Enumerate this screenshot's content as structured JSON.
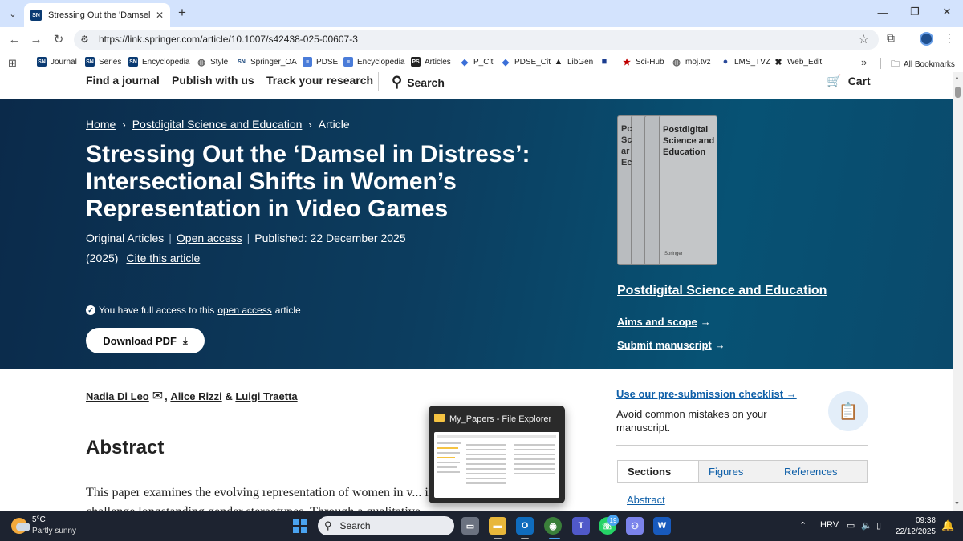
{
  "browser": {
    "tab_title": "Stressing Out the 'Damsel in Di...",
    "url": "https://link.springer.com/article/10.1007/s42438-025-00607-3",
    "bookmarks": [
      {
        "label": "Journal",
        "icon": "SN",
        "color": "#0a3a72"
      },
      {
        "label": "Series",
        "icon": "SN",
        "color": "#0a3a72"
      },
      {
        "label": "Encyclopedia",
        "icon": "SN",
        "color": "#0a3a72"
      },
      {
        "label": "Style",
        "icon": "globe",
        "color": "#666666"
      },
      {
        "label": "Springer_OA",
        "icon": "SN",
        "color": "#ffffff"
      },
      {
        "label": "PDSE",
        "icon": "doc",
        "color": "#4a7cd9"
      },
      {
        "label": "Encyclopedia",
        "icon": "doc",
        "color": "#4a7cd9"
      },
      {
        "label": "Articles",
        "icon": "PS",
        "color": "#222222"
      },
      {
        "label": "P_Cit",
        "icon": "diamond",
        "color": "#3b6fd8"
      },
      {
        "label": "PDSE_Cit",
        "icon": "diamond",
        "color": "#3b6fd8"
      },
      {
        "label": "LibGen",
        "icon": "chart",
        "color": "#222222"
      },
      {
        "label": "",
        "icon": "flag",
        "color": "#1a3c8f"
      },
      {
        "label": "Sci-Hub",
        "icon": "star",
        "color": "#c00000"
      },
      {
        "label": "moj.tvz",
        "icon": "globe",
        "color": "#666666"
      },
      {
        "label": "LMS_TVZ",
        "icon": "circle",
        "color": "#2a4a9a"
      },
      {
        "label": "Web_Edit",
        "icon": "x",
        "color": "#222222"
      }
    ],
    "all_bookmarks": "All Bookmarks"
  },
  "site_nav": {
    "find_journal": "Find a journal",
    "publish": "Publish with us",
    "track": "Track your research",
    "search": "Search",
    "cart": "Cart"
  },
  "breadcrumb": {
    "home": "Home",
    "journal": "Postdigital Science and Education",
    "current": "Article"
  },
  "article": {
    "title": "Stressing Out the ‘Damsel in Distress’: Intersectional Shifts in Women’s Representation in Video Games",
    "type": "Original Articles",
    "open_access": "Open access",
    "published": "Published: 22 December 2025",
    "year": "(2025)",
    "cite": "Cite this article",
    "access_prefix": "You have full access to this",
    "access_link": "open access",
    "access_suffix": "article",
    "download": "Download PDF",
    "authors": [
      {
        "name": "Nadia Di Leo"
      },
      {
        "name": "Alice Rizzi"
      },
      {
        "name": "Luigi Traetta"
      }
    ],
    "author_sep1": ",",
    "author_sep2": "&",
    "abstract_heading": "Abstract",
    "abstract_text": "This paper examines the evolving representation of women in v... intersectional shifts that challenge longstanding gender stereotypes. Through a qualitative"
  },
  "journal": {
    "cover_title": "Postdigital Science and Education",
    "cover_spine": "Pc Sc ar Ec",
    "cover_publisher": "Springer",
    "name": "Postdigital Science and Education",
    "aims": "Aims and scope",
    "submit": "Submit manuscript"
  },
  "sidebar": {
    "checklist_link": "Use our pre-submission checklist",
    "checklist_desc": "Avoid common mistakes on your manuscript.",
    "tabs": [
      "Sections",
      "Figures",
      "References"
    ],
    "first_section": "Abstract"
  },
  "popup": {
    "title": "My_Papers - File Explorer"
  },
  "taskbar": {
    "temp": "5°C",
    "condition": "Partly sunny",
    "search": "Search",
    "whatsapp_badge": "19",
    "lang": "HRV",
    "time": "09:38",
    "date": "22/12/2025"
  }
}
